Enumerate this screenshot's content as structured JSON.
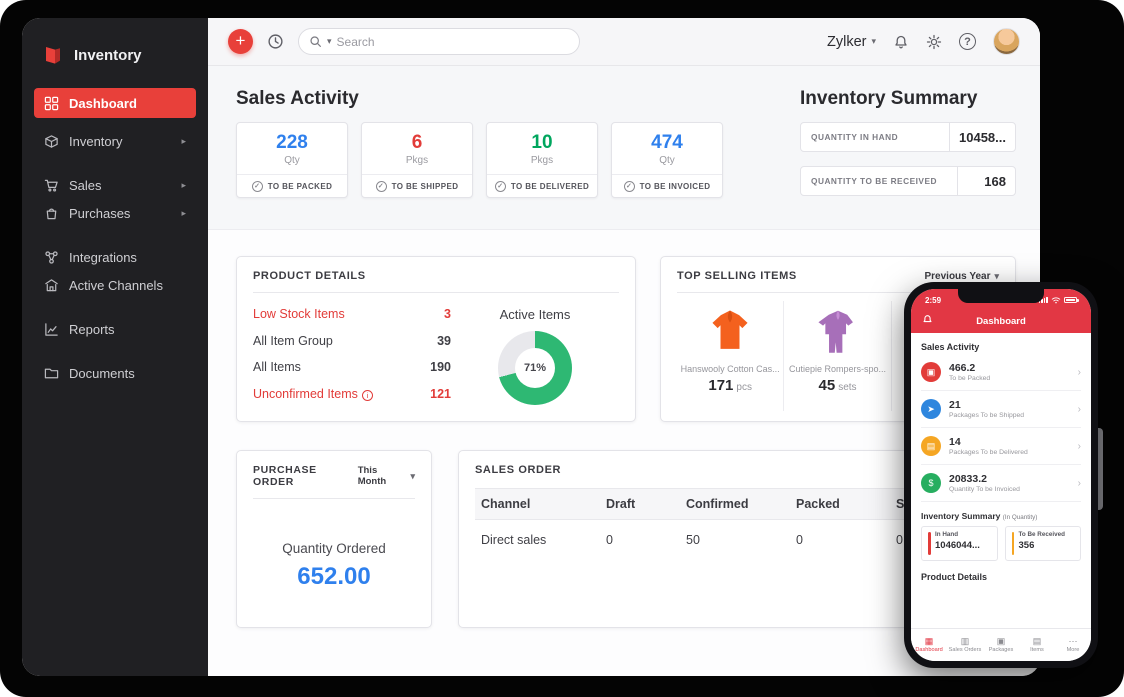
{
  "colors": {
    "brand_red": "#e23744",
    "blue": "#2f80ed",
    "red": "#e23c39",
    "green": "#00a65e",
    "orange": "#f5a623",
    "donut_green": "#2eb873"
  },
  "sidebar": {
    "logo_label": "Inventory",
    "items": [
      {
        "label": "Dashboard"
      },
      {
        "label": "Inventory"
      },
      {
        "label": "Sales"
      },
      {
        "label": "Purchases"
      },
      {
        "label": "Integrations"
      },
      {
        "label": "Active Channels"
      },
      {
        "label": "Reports"
      },
      {
        "label": "Documents"
      }
    ]
  },
  "topbar": {
    "org_name": "Zylker",
    "search_placeholder": "Search"
  },
  "sales_activity": {
    "title": "Sales Activity",
    "cards": [
      {
        "value": "228",
        "unit": "Qty",
        "label": "TO BE PACKED",
        "color": "#2f80ed"
      },
      {
        "value": "6",
        "unit": "Pkgs",
        "label": "TO BE SHIPPED",
        "color": "#e23c39"
      },
      {
        "value": "10",
        "unit": "Pkgs",
        "label": "TO BE DELIVERED",
        "color": "#00a65e"
      },
      {
        "value": "474",
        "unit": "Qty",
        "label": "TO BE INVOICED",
        "color": "#2f80ed"
      }
    ]
  },
  "inventory_summary": {
    "title": "Inventory Summary",
    "rows": [
      {
        "label": "QUANTITY IN HAND",
        "value": "10458..."
      },
      {
        "label": "QUANTITY TO BE RECEIVED",
        "value": "168"
      }
    ]
  },
  "product_details": {
    "title": "PRODUCT DETAILS",
    "rows": [
      {
        "label": "Low Stock Items",
        "value": "3"
      },
      {
        "label": "All Item Group",
        "value": "39"
      },
      {
        "label": "All Items",
        "value": "190"
      },
      {
        "label": "Unconfirmed Items",
        "value": "121"
      }
    ],
    "chart_label": "Active Items",
    "percent": "71%",
    "percent_value": 71
  },
  "top_selling": {
    "title": "TOP SELLING ITEMS",
    "range": "Previous Year",
    "items": [
      {
        "name": "Hanswooly Cotton Cas...",
        "qty": "171",
        "unit": "pcs"
      },
      {
        "name": "Cutiepie Rompers-spo...",
        "qty": "45",
        "unit": "sets"
      }
    ]
  },
  "purchase_order": {
    "title": "PURCHASE ORDER",
    "range": "This Month",
    "label": "Quantity Ordered",
    "value": "652.00"
  },
  "sales_order": {
    "title": "SALES ORDER",
    "columns": [
      "Channel",
      "Draft",
      "Confirmed",
      "Packed",
      "Shipped"
    ],
    "rows": [
      [
        "Direct sales",
        "0",
        "50",
        "0",
        "0"
      ]
    ]
  },
  "phone": {
    "time": "2:59",
    "header": "Dashboard",
    "sales_activity_label": "Sales Activity",
    "items": [
      {
        "value": "466.2",
        "label": "To be Packed",
        "color": "#e23c39"
      },
      {
        "value": "21",
        "label": "Packages To be Shipped",
        "color": "#2e86de"
      },
      {
        "value": "14",
        "label": "Packages To be Delivered",
        "color": "#f5a623"
      },
      {
        "value": "20833.2",
        "label": "Quantity To be Invoiced",
        "color": "#27ae60"
      }
    ],
    "inventory_summary_label": "Inventory Summary",
    "inventory_summary_sub": "(In Quantity)",
    "summary_boxes": [
      {
        "label": "In Hand",
        "value": "1046044...",
        "color": "#e23c39"
      },
      {
        "label": "To Be Received",
        "value": "356",
        "color": "#f5a623"
      }
    ],
    "product_details_label": "Product Details",
    "nav": [
      "Dashboard",
      "Sales Orders",
      "Packages",
      "Items",
      "More"
    ]
  }
}
